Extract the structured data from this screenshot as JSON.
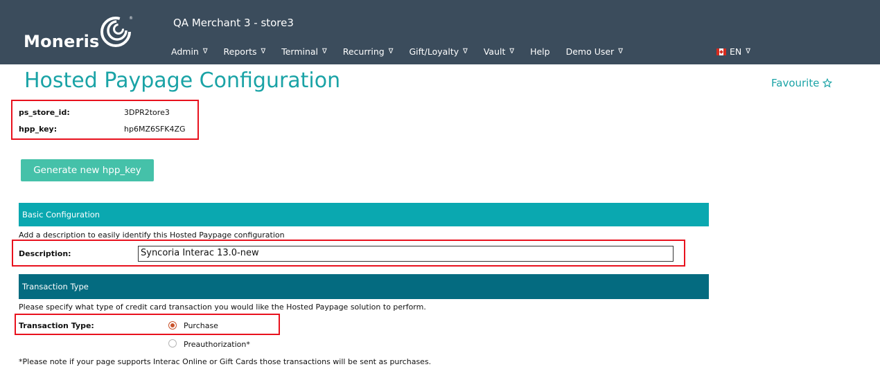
{
  "header": {
    "logo_text": "Moneris",
    "merchant": "QA Merchant 3 - store3",
    "nav": [
      {
        "label": "Admin",
        "caret": "∇"
      },
      {
        "label": "Reports",
        "caret": "∇"
      },
      {
        "label": "Terminal",
        "caret": "∇"
      },
      {
        "label": "Recurring",
        "caret": "∇"
      },
      {
        "label": "Gift/Loyalty",
        "caret": "∇"
      },
      {
        "label": "Vault",
        "caret": "∇"
      },
      {
        "label": "Help",
        "caret": ""
      },
      {
        "label": "Demo User",
        "caret": "∇"
      }
    ],
    "language": {
      "label": "EN",
      "caret": "∇",
      "flag_icon": "canada-flag-icon"
    }
  },
  "page": {
    "title": "Hosted Paypage Configuration",
    "favourite_label": "Favourite",
    "favourite_icon": "star-outline-icon"
  },
  "credentials": {
    "store_id_label": "ps_store_id:",
    "store_id_value": "3DPR2tore3",
    "hpp_key_label": "hpp_key:",
    "hpp_key_value": "hp6MZ6SFK4ZG"
  },
  "generate_button": "Generate new hpp_key",
  "basic": {
    "section_title": "Basic Configuration",
    "help": "Add a description to easily identify this Hosted Paypage configuration",
    "description_label": "Description:",
    "description_value": "Syncoria Interac 13.0-new"
  },
  "transaction": {
    "section_title": "Transaction Type",
    "help": "Please specify what type of credit card transaction you would like the Hosted Paypage solution to perform.",
    "type_label": "Transaction Type:",
    "options": [
      {
        "label": "Purchase",
        "selected": true
      },
      {
        "label": "Preauthorization*",
        "selected": false
      }
    ],
    "note": "*Please note if your page supports Interac Online or Gift Cards those transactions will be sent as purchases."
  },
  "colors": {
    "header_bg": "#3b4c5c",
    "accent_teal": "#1aa3a6",
    "button_green": "#45c1a9",
    "section_basic": "#0aa8b0",
    "section_txn": "#046b80",
    "annotation_red": "#e8111d",
    "radio_selected": "#c9532b"
  }
}
